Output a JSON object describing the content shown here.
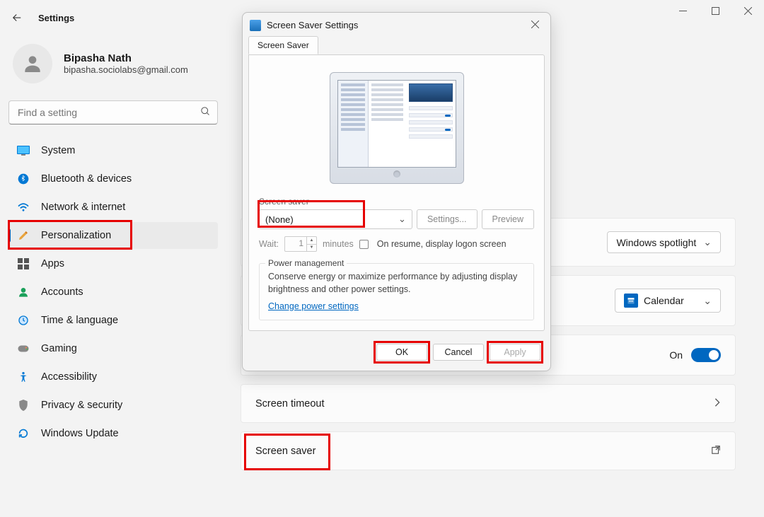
{
  "titlebar": {
    "title": "Settings"
  },
  "profile": {
    "name": "Bipasha Nath",
    "email": "bipasha.sociolabs@gmail.com"
  },
  "search": {
    "placeholder": "Find a setting"
  },
  "nav": {
    "system": "System",
    "bluetooth": "Bluetooth & devices",
    "network": "Network & internet",
    "personalization": "Personalization",
    "apps": "Apps",
    "accounts": "Accounts",
    "time": "Time & language",
    "gaming": "Gaming",
    "accessibility": "Accessibility",
    "privacy": "Privacy & security",
    "update": "Windows Update"
  },
  "dialog": {
    "title": "Screen Saver Settings",
    "tab": "Screen Saver",
    "section_label": "Screen saver",
    "combo_value": "(None)",
    "settings_btn": "Settings...",
    "preview_btn": "Preview",
    "wait_label": "Wait:",
    "wait_value": "1",
    "wait_unit": "minutes",
    "resume_label": "On resume, display logon screen",
    "pm_group": "Power management",
    "pm_text": "Conserve energy or maximize performance by adjusting display brightness and other power settings.",
    "pm_link": "Change power settings",
    "ok": "OK",
    "cancel": "Cancel",
    "apply": "Apply"
  },
  "settings": {
    "spotlight": "Windows spotlight",
    "calendar": "Calendar",
    "toggle_label": "On",
    "timeout": "Screen timeout",
    "saver": "Screen saver"
  }
}
